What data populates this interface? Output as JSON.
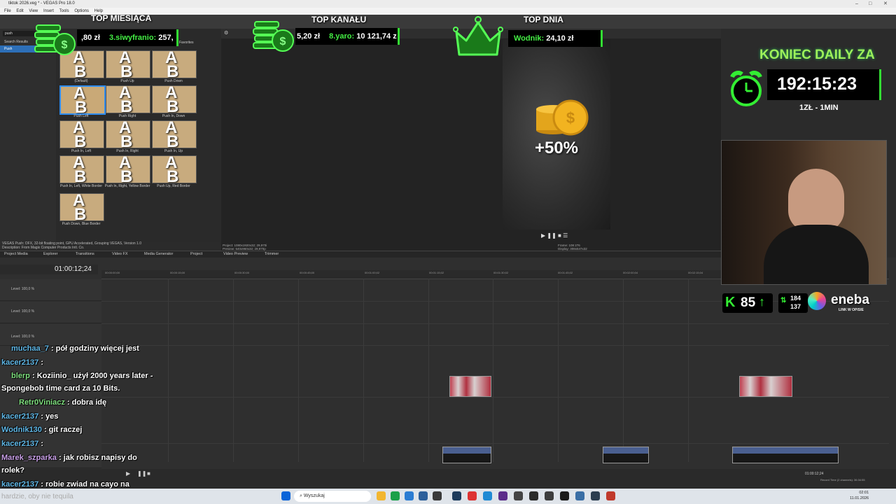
{
  "window": {
    "title": "tiktok 2026.veg * - VEGAS Pro 18.0"
  },
  "menu": [
    "File",
    "Edit",
    "View",
    "Insert",
    "Tools",
    "Options",
    "Help"
  ],
  "explorer": {
    "search_value": "push",
    "tree": [
      "Search Results",
      "Push"
    ],
    "favorites_label": "Favorites"
  },
  "transitions": {
    "items": [
      {
        "label": "(Default)"
      },
      {
        "label": "Push Up"
      },
      {
        "label": "Push Down"
      },
      {
        "label": "Push Left"
      },
      {
        "label": "Push Right"
      },
      {
        "label": "Push In, Down"
      },
      {
        "label": "Push In, Left"
      },
      {
        "label": "Push In, Right"
      },
      {
        "label": "Push In, Up"
      },
      {
        "label": "Push In, Left, White Border"
      },
      {
        "label": "Push In, Right, Yellow Border"
      },
      {
        "label": "Push Up, Red Border"
      },
      {
        "label": "Push Down, Blue Border"
      }
    ],
    "desc1": "VEGAS Push: OFX, 32-bit floating point, GPU Accelerated, Grouping VEGAS, Version 1.0",
    "desc2": "Description: From Magix Computer Products Intl. Co."
  },
  "panel_tabs": [
    "Project Media",
    "Explorer",
    "Transitions",
    "Video FX",
    "Media Generator",
    "Project"
  ],
  "preview": {
    "tabs": [
      "Video Preview",
      "Trimmer"
    ],
    "project": "Project: 1080x1920x32; 29,970i",
    "preview": "Preview: 540x960x32; 29,970p",
    "frame": "Frame: 108 276",
    "display": "Display: 308x547x32",
    "bonus": "+50%"
  },
  "timeline": {
    "timecode": "01:00:12;24",
    "levels": [
      "Level: 100,0 %",
      "Level: 100,0 %",
      "Level: 100,0 %"
    ],
    "ruler": [
      "00:00:00;00",
      "00:00:15;00",
      "00:00:30;00",
      "00:00:45;00",
      "00:01:00;02",
      "00:01:15;02",
      "00:01:30;02",
      "00:01:45;02",
      "00:02:00;04",
      "00:02:15;04"
    ],
    "bottom_time": "01:00:12;24",
    "record_time": "Record Time (2 channels): 36:34:55"
  },
  "overlay": {
    "top_month": {
      "title": "TOP MIESIĄCA",
      "amount": ",80 zł",
      "user": "3.siwyfranio:",
      "value": "257,"
    },
    "top_channel": {
      "title": "TOP KANAŁU",
      "amount": "5,20 zł",
      "user": "8.yaro:",
      "value": "10 121,74 z"
    },
    "top_day": {
      "title": "TOP DNIA",
      "user": "Wodnik:",
      "value": "24,10 zł"
    },
    "countdown": {
      "title": "KONIEC DAILY ZA",
      "time": "192:15:23",
      "rate": "1ZŁ - 1MIN"
    },
    "stats": {
      "kick_count": "85",
      "up": "184",
      "down": "137",
      "brand": "eneba",
      "brand_sub": "LINK W OPISIE"
    }
  },
  "chat": [
    {
      "user": "muchaa_7",
      "text": ": pół godziny więcej jest"
    },
    {
      "user": "kacer2137",
      "text": ":"
    },
    {
      "user": "blerp",
      "text": ": Koziinio_ użył 2000 years later -"
    },
    {
      "user": "",
      "text": "Spongebob time card za 10 Bits."
    },
    {
      "user": "Retr0Viniacz",
      "text": ": dobra idę"
    },
    {
      "user": "kacer2137",
      "text": ": yes"
    },
    {
      "user": "Wodnik130",
      "text": ": git raczej"
    },
    {
      "user": "kacer2137",
      "text": ":"
    },
    {
      "user": "Marek_szparka",
      "text": ": jak robisz napisy do"
    },
    {
      "user": "",
      "text": "rolek?"
    },
    {
      "user": "kacer2137",
      "text": ": robie zwiad na cayo na"
    },
    {
      "user": "",
      "text": "hardzie, oby nie tequila"
    }
  ],
  "taskbar": {
    "search_placeholder": "Wyszukaj",
    "time": "02:01",
    "date": "11.01.2026"
  },
  "colors": {
    "accent": "#33dd33",
    "chat_user": "#5fb8e8",
    "selection": "#2d6fb8"
  }
}
